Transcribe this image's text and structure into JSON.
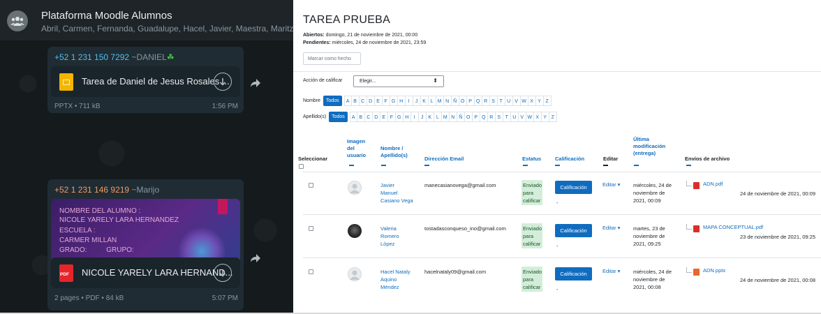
{
  "whatsapp": {
    "group_title": "Plataforma Moodle Alumnos",
    "members": "Abril, Carmen, Fernanda, Guadalupe, Hacel, Javier, Maestra, Maritzel, Paola",
    "messages": [
      {
        "sender_phone": "+52 1 231 150 7292",
        "sender_name": "~DANIEL",
        "sender_emoji": "☘",
        "doc_name": "Tarea de Daniel de Jesus Rosales ...",
        "doc_meta": "PPTX • 711 kB",
        "time": "1:56 PM"
      },
      {
        "sender_phone": "+52 1 231 146 9219",
        "sender_name": "~Marijo",
        "preview_lines": [
          "NOMBRE DEL ALUMNO :",
          "NICOLE YARELY LARA HERNANDEZ",
          "ESCUELA :",
          "CARMER MILLAN",
          "GRADO:          GRUPO:"
        ],
        "doc_name": "NICOLE YARELY LARA HERNAND...",
        "doc_badge": "PDF",
        "doc_meta": "2 pages • PDF • 84 kB",
        "time": "5:07 PM"
      }
    ]
  },
  "moodle": {
    "title": "TAREA PRUEBA",
    "opened_label": "Abiertos:",
    "opened_value": " domingo, 21 de noviembre de 2021, 00:00",
    "due_label": "Pendientes:",
    "due_value": " miércoles, 24 de noviembre de 2021, 23:59",
    "mark_done": "Marcar como hecho",
    "grade_action_label": "Acción de calificar",
    "grade_action_value": "Elegir...",
    "first_name_label": "Nombre",
    "last_name_label": "Apellido(s)",
    "all_label": "Todos",
    "letters": [
      "A",
      "B",
      "C",
      "D",
      "E",
      "F",
      "G",
      "H",
      "I",
      "J",
      "K",
      "L",
      "M",
      "N",
      "Ñ",
      "O",
      "P",
      "Q",
      "R",
      "S",
      "T",
      "U",
      "V",
      "W",
      "X",
      "Y",
      "Z"
    ],
    "headers": {
      "select": "Seleccionar",
      "image": [
        "Imagen",
        "del",
        "usuario"
      ],
      "name": [
        "Nombre /",
        "Apellido(s)"
      ],
      "email": "Dirección Email",
      "status": "Estatus",
      "grade": "Calificación",
      "edit": "Editar",
      "modified": [
        "Última",
        "modificación",
        "(entrega)"
      ],
      "files": "Envíos de archivo"
    },
    "rows": [
      {
        "name": [
          "Javier",
          "Manuel",
          "Casiano Vega"
        ],
        "email": "manecasianovega@gmail.com",
        "status": [
          "Enviado",
          "para",
          "calificar"
        ],
        "grade_button": "Calificación",
        "grade_value": "-",
        "edit": "Editar ▾",
        "modified": [
          "miércoles, 24 de",
          "noviembre de",
          "2021, 00:09"
        ],
        "file_name": "ADN.pdf",
        "file_type": "pdf",
        "file_date": "24 de noviembre de 2021, 00:09"
      },
      {
        "name": [
          "Valeria",
          "Romero",
          "López"
        ],
        "email": "tostadasconqueso_ino@gmail.com",
        "status": [
          "Enviado",
          "para",
          "calificar"
        ],
        "grade_button": "Calificación",
        "grade_value": "-",
        "edit": "Editar ▾",
        "modified": [
          "martes, 23 de",
          "noviembre de",
          "2021, 09:25"
        ],
        "file_name": "MAPA CONCEPTUAL.pdf",
        "file_type": "pdf",
        "file_date": "23 de noviembre de 2021, 09:25"
      },
      {
        "name": [
          "Hacel Nataly",
          "Aquino",
          "Méndez"
        ],
        "email": "hacelnataly09@gmail.com",
        "status": [
          "Enviado",
          "para",
          "calificar"
        ],
        "grade_button": "Calificación",
        "grade_value": "-",
        "edit": "Editar ▾",
        "modified": [
          "miércoles, 24 de",
          "noviembre de",
          "2021, 00:08"
        ],
        "file_name": "ADN.pptx",
        "file_type": "pptx",
        "file_date": "24 de noviembre de 2021, 00:08"
      }
    ]
  },
  "colors": {
    "wa_bg": "#151a1d",
    "wa_bubble": "#202c33",
    "moodle_link": "#0f6cbf",
    "status_bg": "#d4edda",
    "pdf_red": "#d9302c",
    "pptx_orange": "#e8672a"
  }
}
